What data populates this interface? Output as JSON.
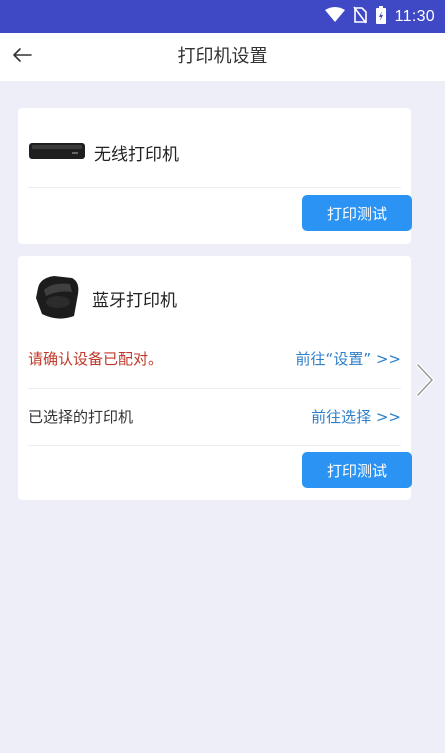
{
  "status_bar": {
    "time": "11:30",
    "icons": [
      "wifi-icon",
      "no-sim-icon",
      "battery-charging-icon"
    ]
  },
  "header": {
    "title": "打印机设置",
    "back_icon": "arrow-left-icon"
  },
  "wireless_printer": {
    "name": "无线打印机",
    "image": "wireless-printer-image",
    "test_button": "打印测试"
  },
  "bluetooth_printer": {
    "name": "蓝牙打印机",
    "image": "bluetooth-printer-image",
    "warning": "请确认设备已配对。",
    "goto_settings": "前往“设置” >>",
    "selected_label": "已选择的打印机",
    "goto_select": "前往选择 >>",
    "test_button": "打印测试"
  },
  "colors": {
    "status_bar": "#3f49c6",
    "background": "#eeeef8",
    "button": "#2b93f3",
    "warning": "#c0392b",
    "link": "#2e7fc9"
  }
}
